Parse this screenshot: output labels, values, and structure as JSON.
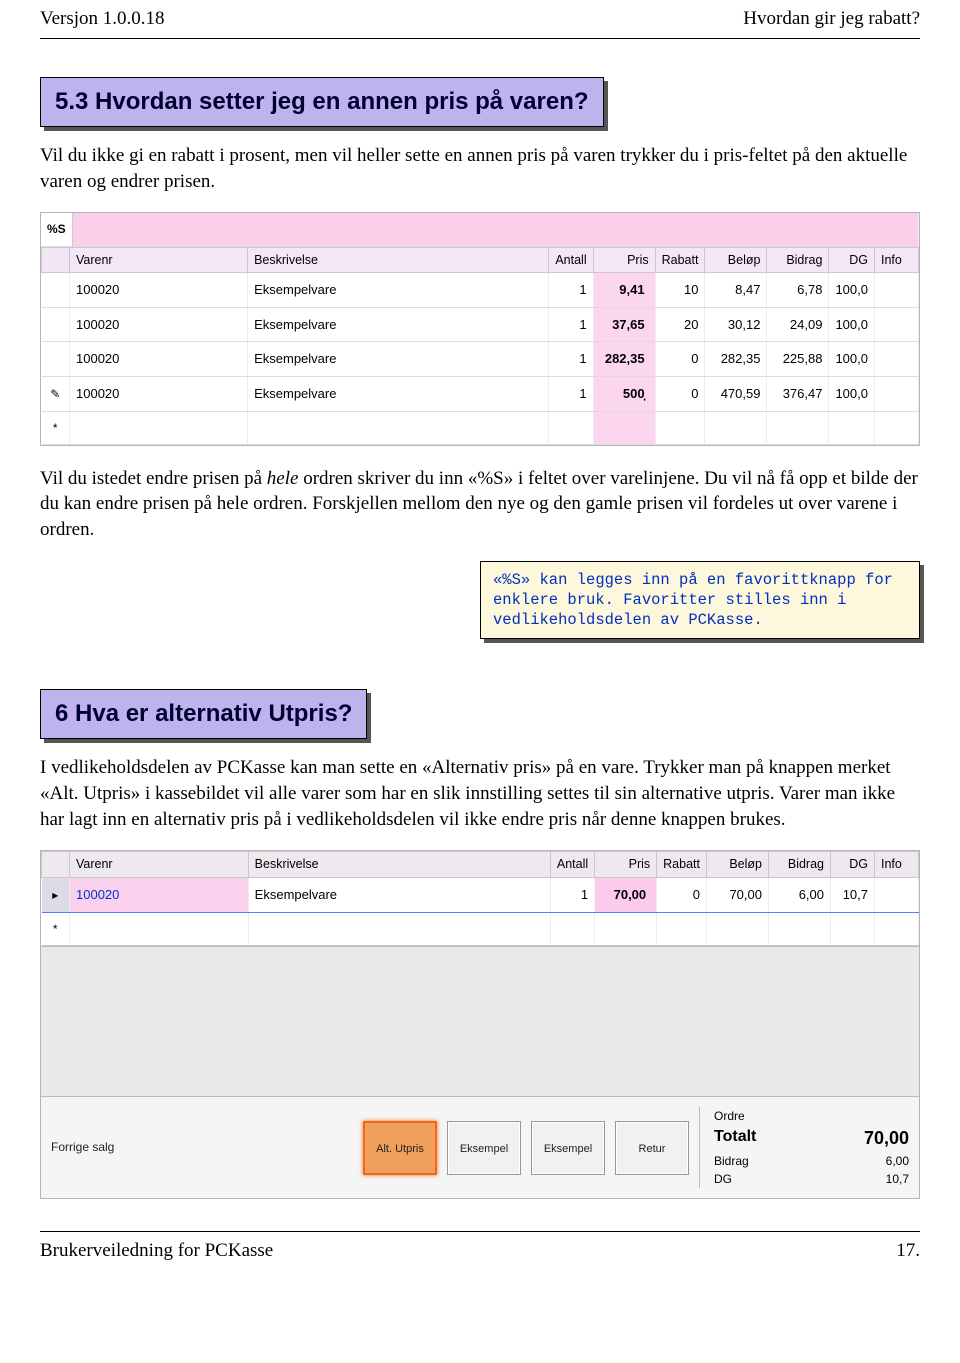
{
  "header": {
    "version": "Versjon 1.0.0.18",
    "title": "Hvordan gir jeg rabatt?"
  },
  "footer": {
    "left": "Brukerveiledning for PCKasse",
    "right": "17."
  },
  "s53": {
    "heading": "5.3  Hvordan setter jeg en annen pris på varen?",
    "body": "Vil du ikke gi en rabatt i prosent, men vil heller sette en annen pris på varen trykker du i pris-feltet på den aktuelle varen og endrer prisen."
  },
  "shot1": {
    "pctLabel": "%S",
    "cols": [
      "Varenr",
      "Beskrivelse",
      "Antall",
      "Pris",
      "Rabatt",
      "Beløp",
      "Bidrag",
      "DG",
      "Info"
    ],
    "rowmarkEdit": "✎",
    "rowmarkStar": "*",
    "rows": [
      {
        "varenr": "100020",
        "besk": "Eksempelvare",
        "antall": "1",
        "pris": "9,41",
        "rabatt": "10",
        "belop": "8,47",
        "bidrag": "6,78",
        "dg": "100,0",
        "info": ""
      },
      {
        "varenr": "100020",
        "besk": "Eksempelvare",
        "antall": "1",
        "pris": "37,65",
        "rabatt": "20",
        "belop": "30,12",
        "bidrag": "24,09",
        "dg": "100,0",
        "info": ""
      },
      {
        "varenr": "100020",
        "besk": "Eksempelvare",
        "antall": "1",
        "pris": "282,35",
        "rabatt": "0",
        "belop": "282,35",
        "bidrag": "225,88",
        "dg": "100,0",
        "info": ""
      },
      {
        "varenr": "100020",
        "besk": "Eksempelvare",
        "antall": "1",
        "pris": "500̦",
        "rabatt": "0",
        "belop": "470,59",
        "bidrag": "376,47",
        "dg": "100,0",
        "info": ""
      }
    ]
  },
  "midpara_a": "Vil du istedet endre prisen på ",
  "midpara_b": "hele",
  "midpara_c": " ordren skriver du inn «%S» i feltet over varelinjene. Du vil nå få opp et bilde der du kan endre prisen på hele ordren. Forskjellen mellom den nye og den gamle prisen vil fordeles ut over varene i ordren.",
  "tip": "«%S» kan legges inn på en favorittknapp for enklere bruk. Favoritter stilles inn i vedlikeholdsdelen av PCKasse.",
  "s6": {
    "heading": "6  Hva er alternativ Utpris?",
    "body": "I vedlikeholdsdelen av PCKasse kan man sette en «Alternativ pris» på en vare. Trykker man på knappen merket «Alt. Utpris» i kassebildet vil alle varer som har en slik innstilling settes til sin alternative utpris. Varer man ikke har lagt inn en alternativ pris på i vedlikeholdsdelen vil ikke endre pris når denne knappen brukes."
  },
  "shot2": {
    "cols": [
      "Varenr",
      "Beskrivelse",
      "Antall",
      "Pris",
      "Rabatt",
      "Beløp",
      "Bidrag",
      "DG",
      "Info"
    ],
    "row": {
      "mark": "▸",
      "varenr": "100020",
      "besk": "Eksempelvare",
      "antall": "1",
      "pris": "70,00",
      "rabatt": "0",
      "belop": "70,00",
      "bidrag": "6,00",
      "dg": "10,7",
      "info": ""
    },
    "star": "*",
    "forrige": "Forrige salg",
    "btns": [
      "Alt. Utpris",
      "Eksempel",
      "Eksempel",
      "Retur"
    ],
    "totals": {
      "ordre": "Ordre",
      "totalt_k": "Totalt",
      "totalt_v": "70,00",
      "bidrag_k": "Bidrag",
      "bidrag_v": "6,00",
      "dg_k": "DG",
      "dg_v": "10,7"
    }
  }
}
